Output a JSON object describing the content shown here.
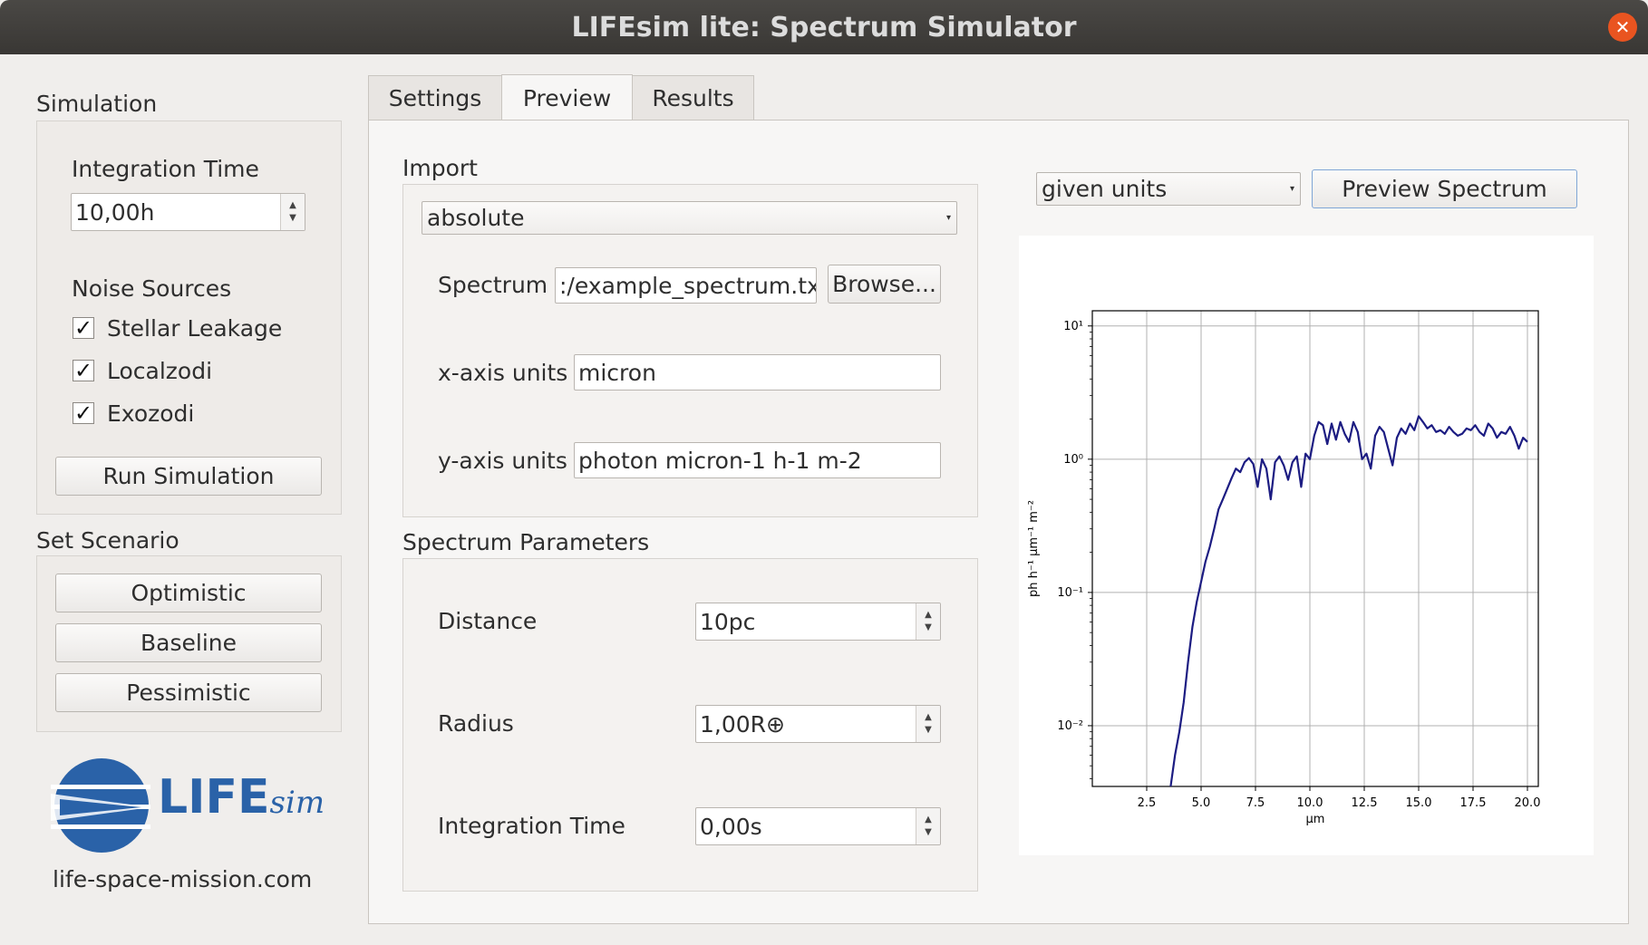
{
  "window": {
    "title": "LIFEsim lite: Spectrum Simulator",
    "close_glyph": "✕"
  },
  "sidebar": {
    "simulation_heading": "Simulation",
    "integration_time_label": "Integration Time",
    "integration_time_value": "10,00h",
    "noise_sources_label": "Noise Sources",
    "noise_sources": [
      {
        "label": "Stellar Leakage",
        "checked": true
      },
      {
        "label": "Localzodi",
        "checked": true
      },
      {
        "label": "Exozodi",
        "checked": true
      }
    ],
    "check_glyph": "✓",
    "run_button": "Run Simulation",
    "scenario_heading": "Set Scenario",
    "scenario_buttons": [
      "Optimistic",
      "Baseline",
      "Pessimistic"
    ],
    "logo_text": "LIFE",
    "logo_suffix": "sim",
    "website": "life-space-mission.com"
  },
  "tabs": [
    {
      "label": "Settings",
      "active": false
    },
    {
      "label": "Preview",
      "active": true
    },
    {
      "label": "Results",
      "active": false
    }
  ],
  "import": {
    "heading": "Import",
    "mode": "absolute",
    "spectrum_label": "Spectrum",
    "spectrum_value": ":/example_spectrum.txt",
    "browse_button": "Browse...",
    "x_units_label": "x-axis units",
    "x_units_value": "micron",
    "y_units_label": "y-axis units",
    "y_units_value": "photon micron-1 h-1 m-2"
  },
  "parameters": {
    "heading": "Spectrum Parameters",
    "distance_label": "Distance",
    "distance_value": "10pc",
    "radius_label": "Radius",
    "radius_value": "1,00R⊕",
    "integration_label": "Integration Time",
    "integration_value": "0,00s"
  },
  "preview": {
    "units_select": "given units",
    "preview_button": "Preview Spectrum"
  },
  "chart_data": {
    "type": "line",
    "xlabel": "μm",
    "ylabel": "ph h⁻¹ μm⁻¹ m⁻²",
    "yscale": "log",
    "xlim": [
      0.0,
      20.5
    ],
    "ylim": [
      0.0035,
      13
    ],
    "grid": true,
    "xticks": [
      "2.5",
      "5.0",
      "7.5",
      "10.0",
      "12.5",
      "15.0",
      "17.5",
      "20.0"
    ],
    "yticks": [
      "10⁻²",
      "10⁻¹",
      "10⁰",
      "10¹"
    ],
    "line_color": "#1c1c82",
    "series": [
      {
        "x": [
          3.6,
          3.8,
          4.0,
          4.2,
          4.4,
          4.6,
          4.8,
          5.0,
          5.2,
          5.4,
          5.6,
          5.8,
          6.0,
          6.2,
          6.4,
          6.6,
          6.8,
          7.0,
          7.2,
          7.4,
          7.6,
          7.8,
          8.0,
          8.2,
          8.4,
          8.6,
          8.8,
          9.0,
          9.2,
          9.4,
          9.6,
          9.8,
          10.0,
          10.2,
          10.4,
          10.6,
          10.8,
          11.0,
          11.2,
          11.4,
          11.6,
          11.8,
          12.0,
          12.2,
          12.4,
          12.6,
          12.8,
          13.0,
          13.2,
          13.4,
          13.6,
          13.8,
          14.0,
          14.2,
          14.4,
          14.6,
          14.8,
          15.0,
          15.2,
          15.4,
          15.6,
          15.8,
          16.0,
          16.2,
          16.4,
          16.6,
          16.8,
          17.0,
          17.2,
          17.4,
          17.6,
          17.8,
          18.0,
          18.2,
          18.4,
          18.6,
          18.8,
          19.0,
          19.2,
          19.4,
          19.6,
          19.8,
          20.0
        ],
        "y": [
          0.0035,
          0.006,
          0.009,
          0.015,
          0.03,
          0.055,
          0.085,
          0.12,
          0.17,
          0.22,
          0.3,
          0.42,
          0.5,
          0.6,
          0.72,
          0.85,
          0.8,
          0.95,
          1.02,
          0.92,
          0.62,
          1.0,
          0.85,
          0.5,
          0.95,
          1.05,
          0.9,
          0.7,
          0.95,
          1.05,
          0.62,
          1.1,
          1.0,
          1.5,
          1.9,
          1.8,
          1.3,
          1.85,
          1.4,
          1.9,
          1.55,
          1.35,
          1.9,
          1.6,
          1.0,
          1.1,
          0.85,
          1.5,
          1.75,
          1.6,
          1.2,
          0.9,
          1.45,
          1.7,
          1.55,
          1.85,
          1.65,
          2.1,
          1.9,
          1.7,
          1.8,
          1.6,
          1.65,
          1.55,
          1.75,
          1.6,
          1.5,
          1.55,
          1.7,
          1.65,
          1.8,
          1.6,
          1.5,
          1.85,
          1.7,
          1.45,
          1.6,
          1.55,
          1.75,
          1.5,
          1.2,
          1.45,
          1.35
        ]
      }
    ]
  }
}
